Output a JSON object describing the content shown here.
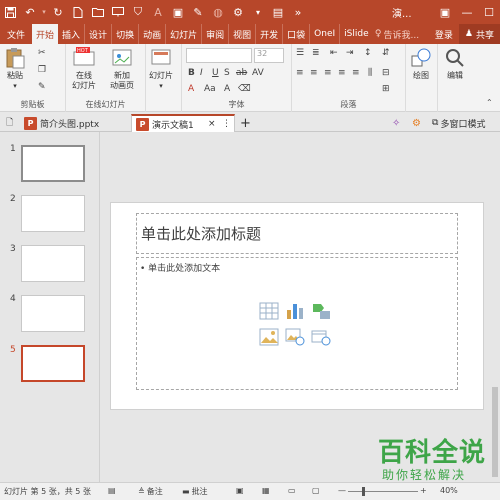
{
  "app": {
    "title": "演...",
    "accent": "#b7472a"
  },
  "quick_access": {
    "icons": [
      "save-icon",
      "undo-icon",
      "redo-icon",
      "new-document-icon",
      "open-folder-icon",
      "mode-icon",
      "format-painter-icon",
      "font-a-icon",
      "picture-icon",
      "brush-icon",
      "settings-icon"
    ]
  },
  "tabs": [
    {
      "label": "文件",
      "active": false
    },
    {
      "label": "开始",
      "active": true
    },
    {
      "label": "插入",
      "active": false
    },
    {
      "label": "设计",
      "active": false
    },
    {
      "label": "切换",
      "active": false
    },
    {
      "label": "动画",
      "active": false
    },
    {
      "label": "幻灯片",
      "active": false
    },
    {
      "label": "审阅",
      "active": false
    },
    {
      "label": "视图",
      "active": false
    },
    {
      "label": "开发",
      "active": false
    },
    {
      "label": "口袋",
      "active": false
    },
    {
      "label": "OneI",
      "active": false
    },
    {
      "label": "iSlide",
      "active": false
    }
  ],
  "tell_me": "告诉我...",
  "login": "登录",
  "share": "共享",
  "ribbon": {
    "clipboard": {
      "paste": "粘贴",
      "label": "剪贴板"
    },
    "online": {
      "btn1": "在线\n幻灯片",
      "btn2": "新加\n动画页",
      "label": "在线幻灯片"
    },
    "slides": {
      "btn": "幻灯片",
      "label": ""
    },
    "font": {
      "size": "32",
      "label": "字体"
    },
    "paragraph": {
      "label": "段落"
    },
    "drawing": {
      "btn": "绘图"
    },
    "editing": {
      "btn": "编辑"
    }
  },
  "doc_tabs": [
    {
      "label": "简介头图.pptx",
      "active": false
    },
    {
      "label": "演示文稿1",
      "active": true
    }
  ],
  "multi_window": "多窗口模式",
  "slides": [
    {
      "num": "1"
    },
    {
      "num": "2"
    },
    {
      "num": "3"
    },
    {
      "num": "4"
    },
    {
      "num": "5"
    }
  ],
  "slide": {
    "title_placeholder": "单击此处添加标题",
    "body_placeholder": "• 单击此处添加文本"
  },
  "status": {
    "slide_info": "幻灯片 第 5 张，共 5 张",
    "notes": "备注",
    "comments": "批注",
    "zoom": "40%"
  },
  "watermark": {
    "main": "百科全说",
    "sub": "助你轻松解决"
  }
}
